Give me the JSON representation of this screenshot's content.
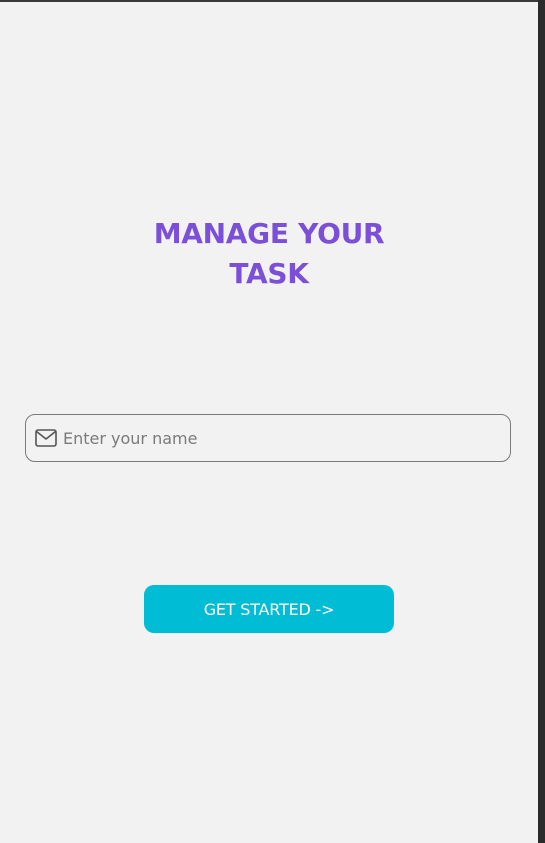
{
  "title": {
    "line1": "MANAGE YOUR",
    "line2": "TASK"
  },
  "name_field": {
    "placeholder": "Enter your name",
    "value": "",
    "icon": "mail-icon"
  },
  "start_button": {
    "label": "GET STARTED ->"
  },
  "colors": {
    "title": "#7b4fd8",
    "button_bg": "#00bcd4",
    "background": "#f2f2f2"
  }
}
